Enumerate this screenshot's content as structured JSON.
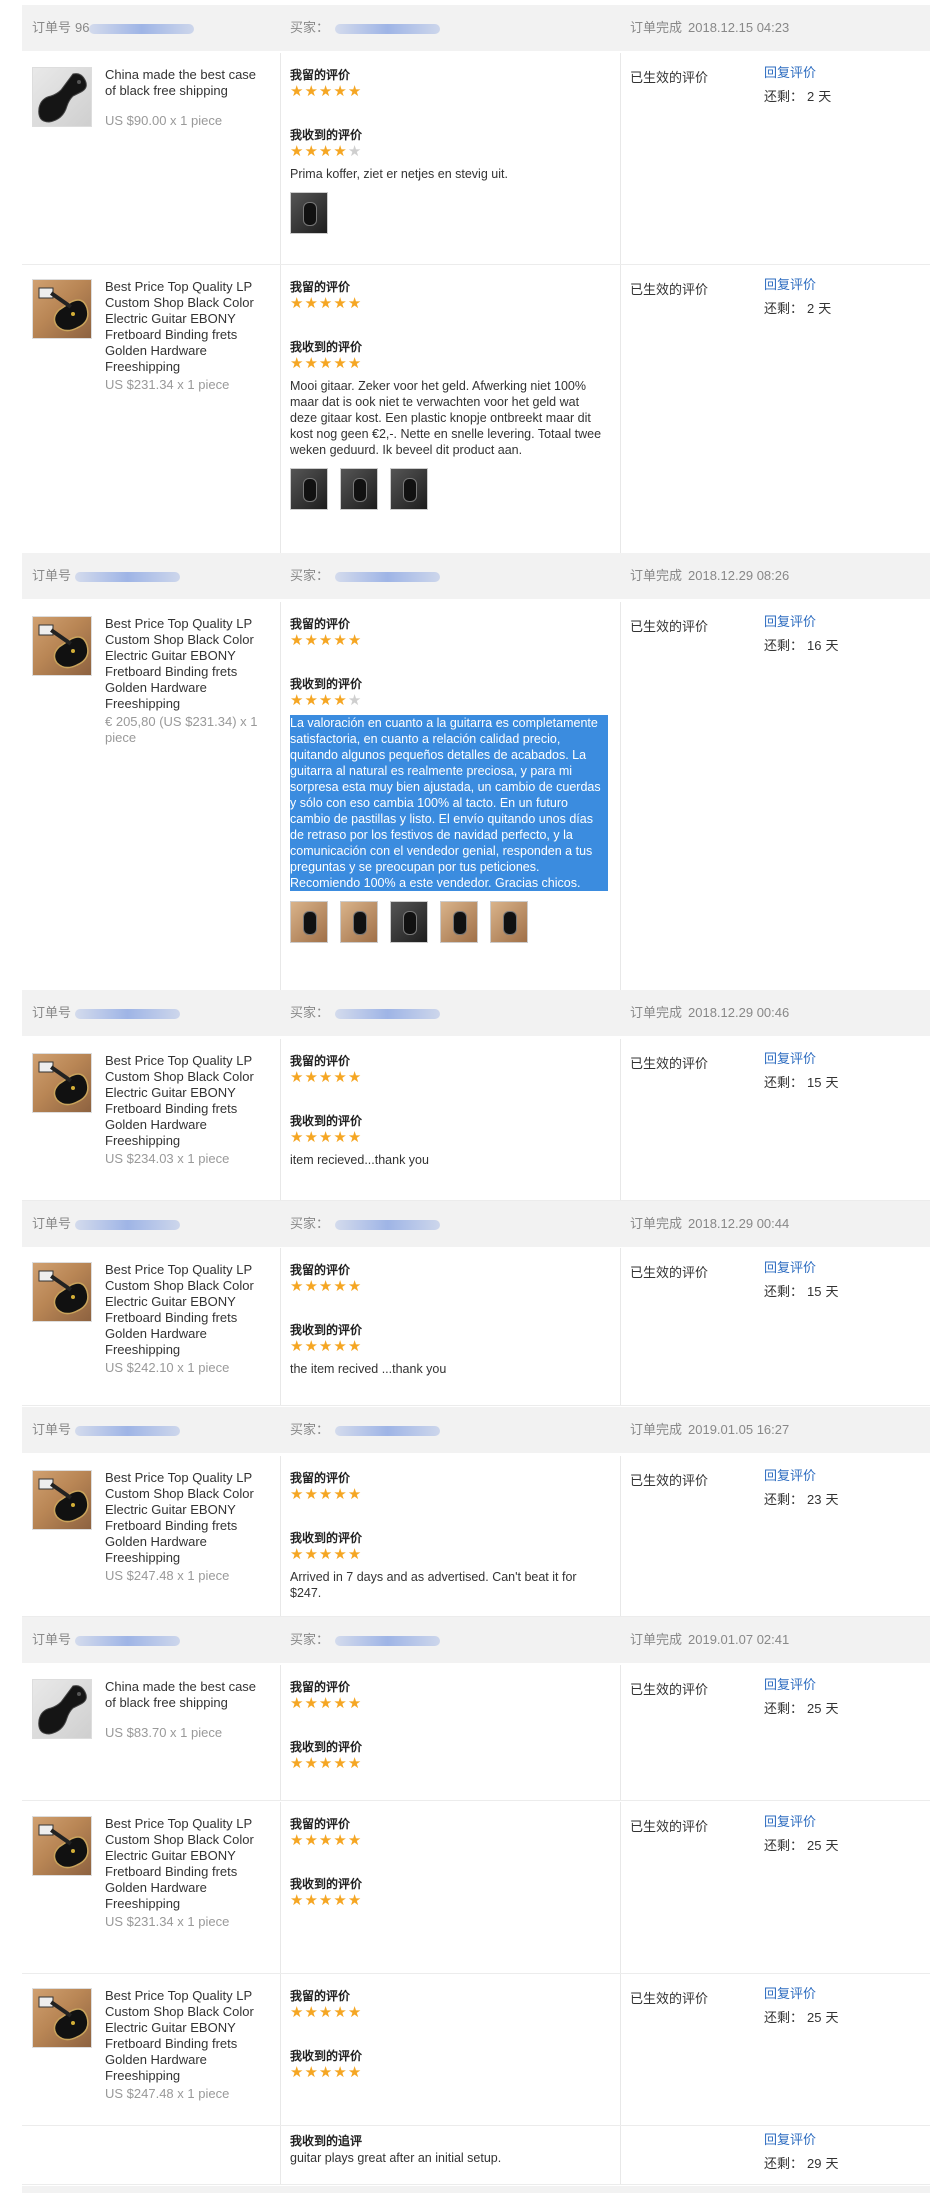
{
  "labels": {
    "order_no": "订单号",
    "buyer": "买家：",
    "order_complete": "订单完成",
    "my_review": "我留的评价",
    "received_review": "我收到的评价",
    "received_append": "我收到的追评",
    "effective": "已生效的评价",
    "reply": "回复评价",
    "remaining_prefix": "还剩：",
    "days_suffix": "天"
  },
  "orders": [
    {
      "order_no_visible": "96",
      "complete_time": "2018.12.15 04:23",
      "items": [
        {
          "image": "case",
          "title": "China made the best case of black free shipping",
          "price": "US $90.00 x 1 piece",
          "my_stars": 5,
          "received_stars": 4,
          "comment": "Prima koffer, ziet er netjes en stevig uit.",
          "selected": false,
          "photos": [
            "dark"
          ],
          "days": "2"
        },
        {
          "image": "guitar",
          "title": "Best Price Top Quality LP Custom Shop Black Color Electric Guitar EBONY Fretboard Binding frets Golden Hardware Freeshipping",
          "price": "US $231.34 x 1 piece",
          "my_stars": 5,
          "received_stars": 5,
          "comment": "Mooi gitaar. Zeker voor het geld. Afwerking niet 100% maar dat is ook niet te verwachten voor het geld wat deze gitaar kost. Een plastic knopje ontbreekt maar dit kost nog geen €2,-. Nette en snelle levering. Totaal twee weken geduurd. Ik beveel dit product aan.",
          "selected": false,
          "photos": [
            "dark",
            "dark",
            "dark"
          ],
          "days": "2"
        }
      ]
    },
    {
      "order_no_visible": "",
      "complete_time": "2018.12.29 08:26",
      "items": [
        {
          "image": "guitar",
          "title": "Best Price Top Quality LP Custom Shop Black Color Electric Guitar EBONY Fretboard Binding frets Golden Hardware Freeshipping",
          "price": "€ 205,80 (US $231.34) x 1 piece",
          "my_stars": 5,
          "received_stars": 4,
          "comment": "La valoración en cuanto a la guitarra es completamente satisfactoria, en cuanto a relación calidad precio, quitando algunos pequeños detalles de acabados. La guitarra al natural es realmente preciosa, y para mi sorpresa esta muy bien ajustada, un cambio de cuerdas y sólo con eso cambia 100% al tacto. En un futuro cambio de pastillas y listo. El envío quitando unos días de retraso por los festivos de navidad perfecto, y la comunicación con el vendedor genial, responden a tus preguntas y se preocupan por tus peticiones. Recomiendo 100% a este vendedor. Gracias chicos.",
          "selected": true,
          "photos": [
            "warm",
            "warm",
            "dark",
            "warm",
            "warm"
          ],
          "days": "16"
        }
      ]
    },
    {
      "order_no_visible": "",
      "complete_time": "2018.12.29 00:46",
      "items": [
        {
          "image": "guitar",
          "title": "Best Price Top Quality LP Custom Shop Black Color Electric Guitar EBONY Fretboard Binding frets Golden Hardware Freeshipping",
          "price": "US $234.03 x 1 piece",
          "my_stars": 5,
          "received_stars": 5,
          "comment": "item recieved...thank you",
          "selected": false,
          "photos": [],
          "days": "15"
        }
      ]
    },
    {
      "order_no_visible": "",
      "complete_time": "2018.12.29 00:44",
      "items": [
        {
          "image": "guitar",
          "title": "Best Price Top Quality LP Custom Shop Black Color Electric Guitar EBONY Fretboard Binding frets Golden Hardware Freeshipping",
          "price": "US $242.10 x 1 piece",
          "my_stars": 5,
          "received_stars": 5,
          "comment": "the item recived ...thank you",
          "selected": false,
          "photos": [],
          "days": "15"
        }
      ]
    },
    {
      "order_no_visible": "",
      "complete_time": "2019.01.05 16:27",
      "items": [
        {
          "image": "guitar",
          "title": "Best Price Top Quality LP Custom Shop Black Color Electric Guitar EBONY Fretboard Binding frets Golden Hardware Freeshipping",
          "price": "US $247.48 x 1 piece",
          "my_stars": 5,
          "received_stars": 5,
          "comment": "Arrived in 7 days and as advertised. Can't beat it for $247.",
          "selected": false,
          "photos": [],
          "days": "23"
        }
      ]
    },
    {
      "order_no_visible": "",
      "complete_time": "2019.01.07 02:41",
      "items": [
        {
          "image": "case",
          "title": "China made the best case of black free shipping",
          "price": "US $83.70 x 1 piece",
          "my_stars": 5,
          "received_stars": 5,
          "comment": "",
          "selected": false,
          "photos": [],
          "days": "25"
        },
        {
          "image": "guitar",
          "title": "Best Price Top Quality LP Custom Shop Black Color Electric Guitar EBONY Fretboard Binding frets Golden Hardware Freeshipping",
          "price": "US $231.34 x 1 piece",
          "my_stars": 5,
          "received_stars": 5,
          "comment": "",
          "selected": false,
          "photos": [],
          "days": "25"
        },
        {
          "image": "guitar",
          "title": "Best Price Top Quality LP Custom Shop Black Color Electric Guitar EBONY Fretboard Binding frets Golden Hardware Freeshipping",
          "price": "US $247.48 x 1 piece",
          "my_stars": 5,
          "received_stars": 5,
          "comment": "",
          "selected": false,
          "photos": [],
          "days": "25"
        }
      ],
      "append": {
        "comment": "guitar plays great after an initial setup.",
        "days": "29"
      }
    }
  ]
}
